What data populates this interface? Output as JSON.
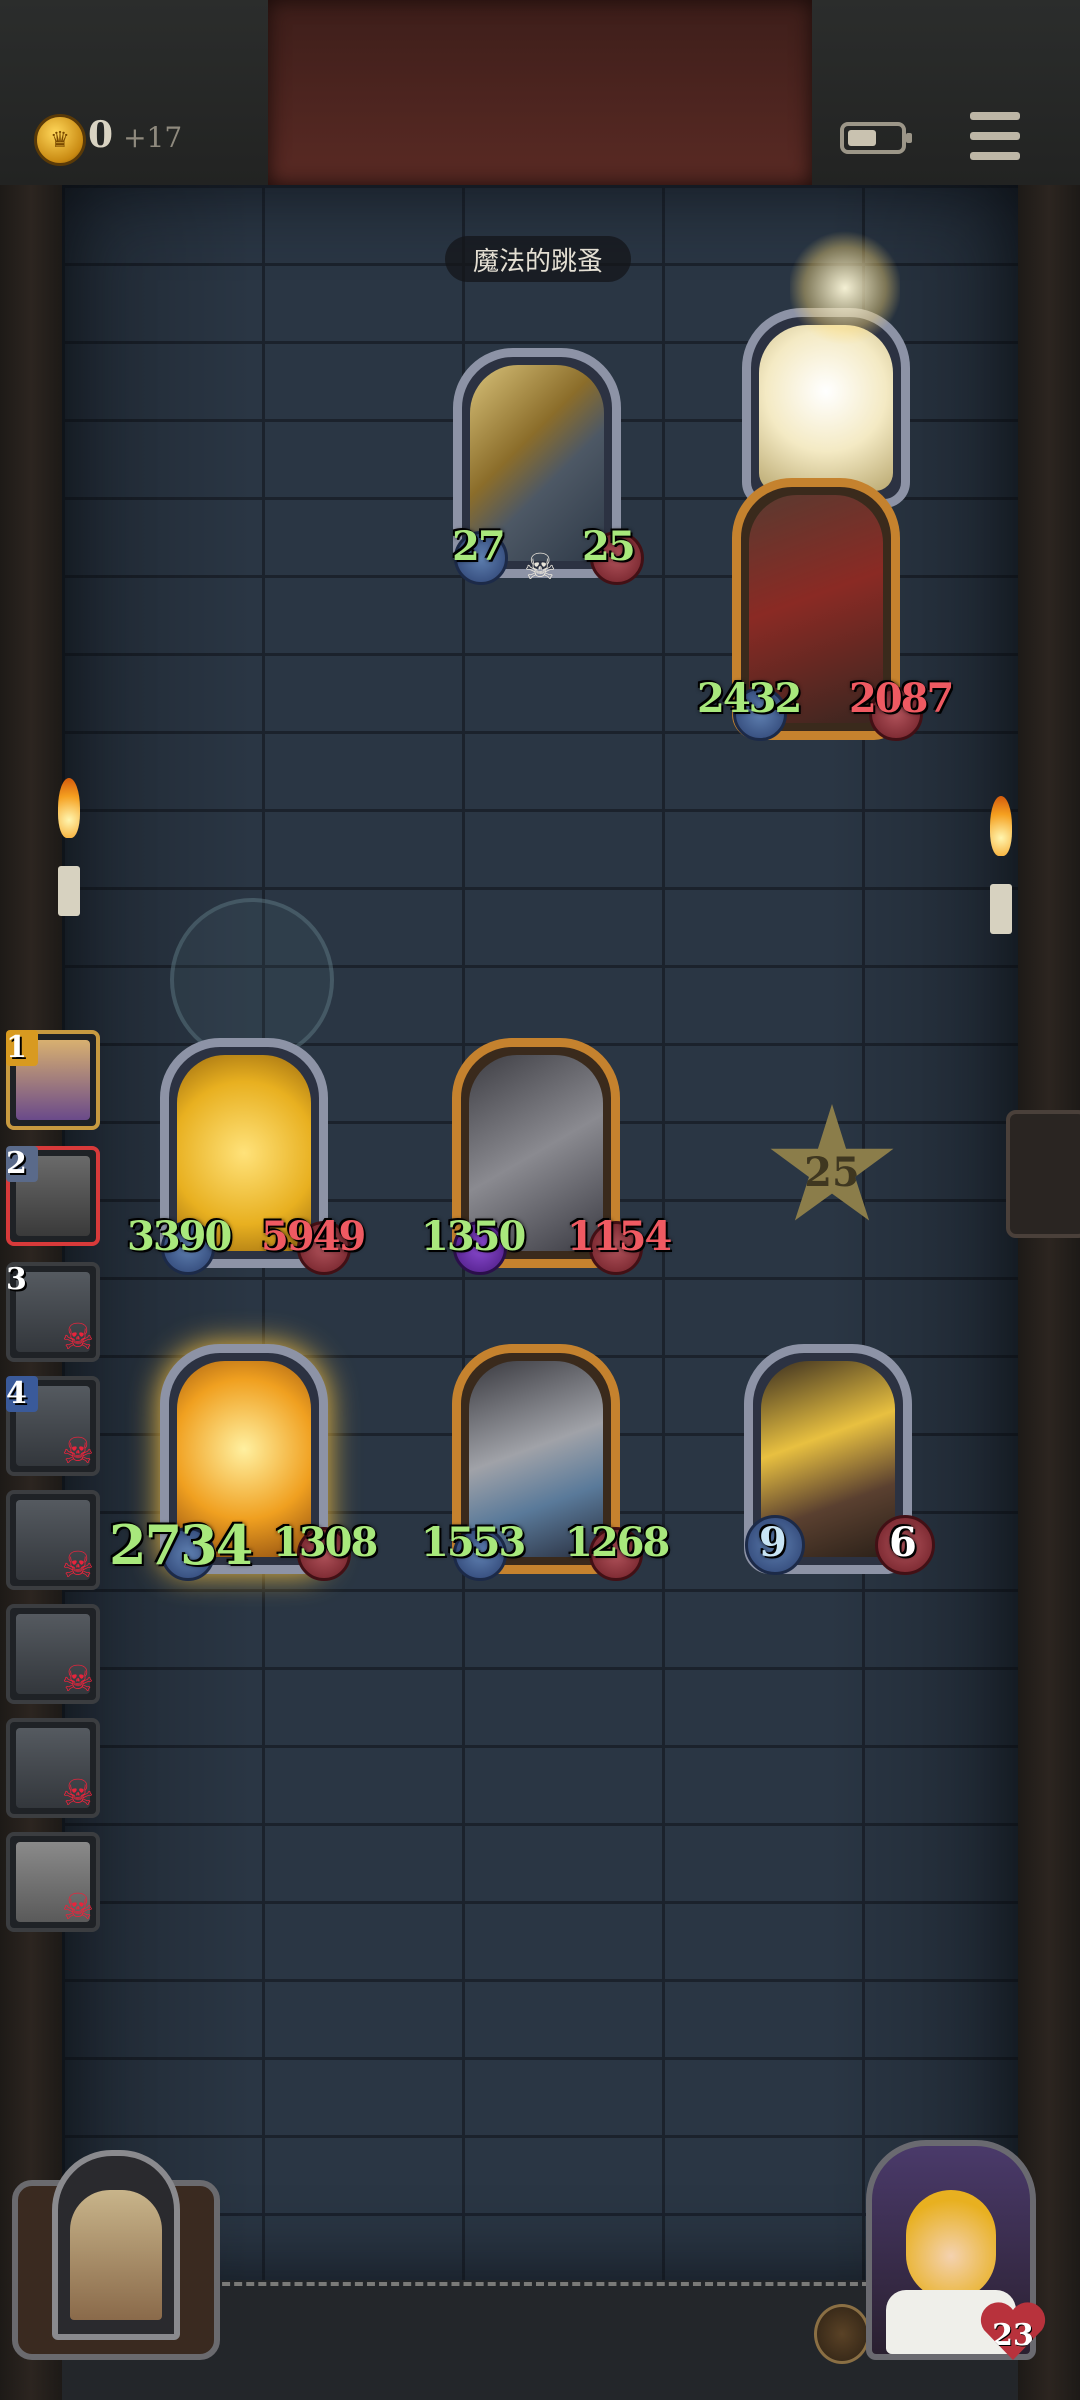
{
  "hud": {
    "gold_icon": "coin-crown-icon",
    "gold": "0",
    "gold_income": "+17",
    "battery_level": 0.55,
    "battery_icon": "battery-icon",
    "menu_icon": "hamburger-menu-icon"
  },
  "board": {
    "enemy_name": "魔法的跳蚤",
    "enemy_cards": [
      {
        "name": "enemy-card-gray-dragon",
        "atk": "27",
        "hp": "25",
        "icon": "skull-icon"
      },
      {
        "name": "enemy-card-serpent-dragon",
        "atk": "2432",
        "hp": "2087"
      }
    ],
    "player_row1": [
      {
        "name": "player-card-golden-dragon",
        "atk": "3390",
        "hp": "5949"
      },
      {
        "name": "player-card-horned-gray-dragon",
        "atk": "1350",
        "hp": "1154"
      }
    ],
    "player_row2": [
      {
        "name": "player-card-fire-demon",
        "atk": "2734",
        "hp": "1308"
      },
      {
        "name": "player-card-dragon-lord",
        "atk": "1553",
        "hp": "1268"
      },
      {
        "name": "player-card-flame-sage",
        "atk": "9",
        "hp": "6"
      }
    ],
    "turn_star": "25"
  },
  "roster": [
    {
      "num": "1",
      "alive": true
    },
    {
      "num": "2",
      "alive": true
    },
    {
      "num": "3",
      "alive": false
    },
    {
      "num": "4",
      "alive": false
    },
    {
      "num": "",
      "alive": false
    },
    {
      "num": "",
      "alive": false
    },
    {
      "num": "",
      "alive": false
    },
    {
      "num": "",
      "alive": false
    }
  ],
  "hero": {
    "hp": "23",
    "hp_icon": "heart-icon",
    "bell_icon": "bell-icon",
    "shop_icon": "shop-window-icon"
  }
}
